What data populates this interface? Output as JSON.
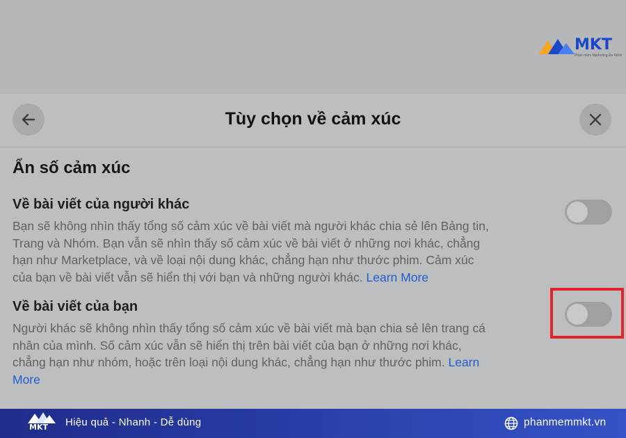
{
  "brand": {
    "logo_text": "MKT",
    "logo_subtitle": "Phần mềm Marketing Đa Kênh",
    "colors": {
      "blue": "#1c47c9",
      "orange": "#f5a623",
      "highlight": "#e3232a"
    }
  },
  "sheet": {
    "title": "Tùy chọn về cảm xúc",
    "back_icon": "arrow-left-icon",
    "close_icon": "close-icon"
  },
  "section": {
    "title": "Ẩn số cảm xúc"
  },
  "options": [
    {
      "title": "Về bài viết của người khác",
      "lines": [
        "Bạn sẽ không nhìn thấy tổng số cảm xúc về bài viết mà người khác chia sẻ lên Bảng tin,",
        "Trang và Nhóm. Bạn vẫn sẽ nhìn thấy số cảm xúc về bài viết ở những nơi khác, chẳng",
        "hạn như Marketplace, và về loại nội dung khác, chẳng hạn như thước phim. Cảm xúc",
        "của bạn về bài viết vẫn sẽ hiển thị với bạn và những người khác."
      ],
      "learn_more": "Learn More",
      "toggle_on": false
    },
    {
      "title": "Về bài viết của bạn",
      "lines": [
        "Người khác sẽ không nhìn thấy tổng số cảm xúc về bài viết mà bạn chia sẻ lên trang cá",
        "nhân của mình. Số cảm xúc vẫn sẽ hiển thị trên bài viết của bạn ở những nơi khác,",
        "chẳng hạn như nhóm, hoặc trên loại nội dung khác, chẳng hạn như thước phim."
      ],
      "learn_more_1": "Learn",
      "learn_more_2": "More",
      "toggle_on": false
    }
  ],
  "footer": {
    "logo_text": "MKT",
    "slogan": "Hiệu quả - Nhanh - Dễ dùng",
    "site": "phanmemmkt.vn",
    "globe_icon": "globe-icon"
  }
}
